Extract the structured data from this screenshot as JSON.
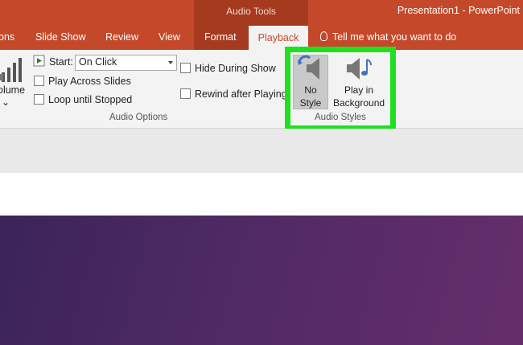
{
  "window": {
    "app_title": "Presentation1 - PowerPoint",
    "contextual_group": "Audio Tools"
  },
  "tabs": [
    {
      "label": "ons"
    },
    {
      "label": "Slide Show"
    },
    {
      "label": "Review"
    },
    {
      "label": "View"
    },
    {
      "label": "Format"
    },
    {
      "label": "Playback",
      "active": true
    }
  ],
  "tell_me": "Tell me what you want to do",
  "ribbon": {
    "volume_label": "Volume",
    "volume_label_partial": "olume",
    "start_label": "Start:",
    "start_value": "On Click",
    "play_across_slides": "Play Across Slides",
    "loop_until_stopped": "Loop until Stopped",
    "hide_during_show": "Hide During Show",
    "rewind_after_playing": "Rewind after Playing",
    "audio_options_label": "Audio Options",
    "no_style_line1": "No",
    "no_style_line2": "Style",
    "play_bg_line1": "Play in",
    "play_bg_line2": "Background",
    "audio_styles_label": "Audio Styles"
  },
  "colors": {
    "title_bar": "#c4492a",
    "contextual_tab": "#a53a1f",
    "ribbon": "#f3f3f3",
    "highlight": "#1ee01e",
    "slide": "#4f2a63"
  }
}
